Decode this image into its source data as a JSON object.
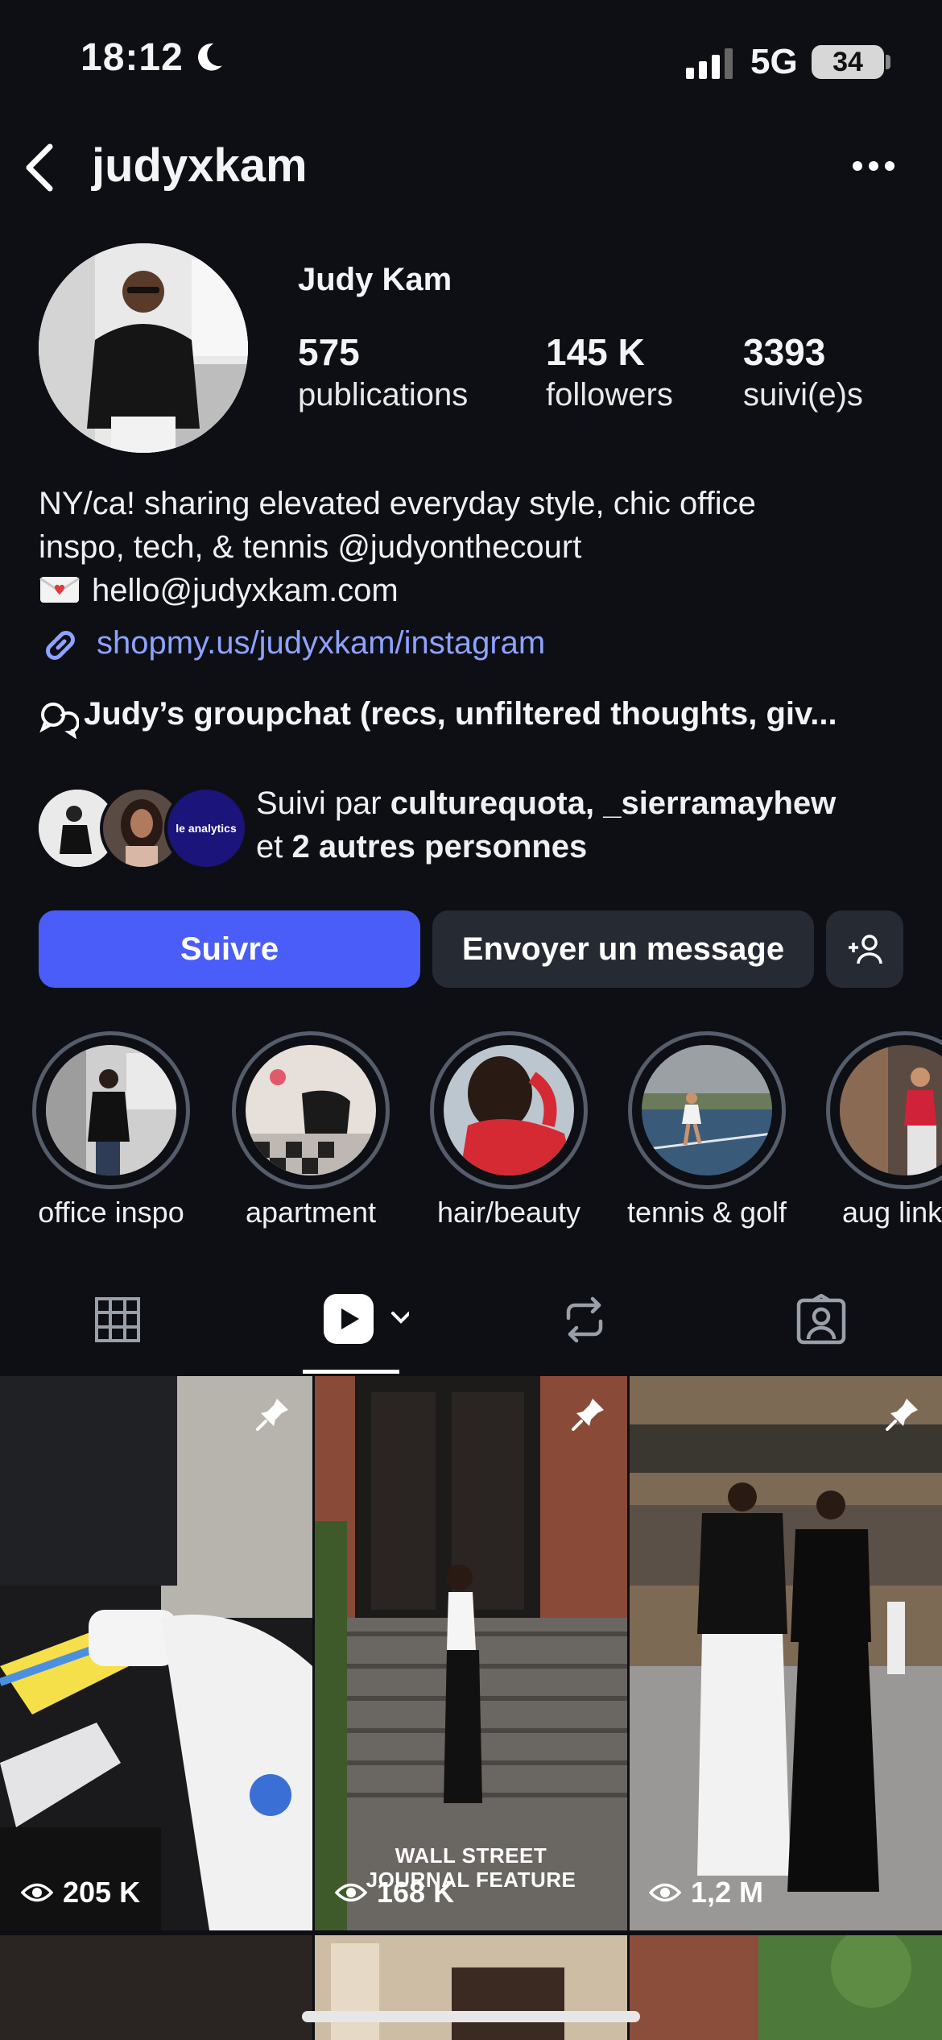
{
  "status_bar": {
    "time": "18:12",
    "network": "5G",
    "battery": "34"
  },
  "header": {
    "username": "judyxkam"
  },
  "profile": {
    "display_name": "Judy Kam",
    "stats": [
      {
        "value": "575",
        "label": "publications"
      },
      {
        "value": "145 K",
        "label": "followers"
      },
      {
        "value": "3393",
        "label": "suivi(e)s"
      }
    ],
    "bio_line1": "NY/ca! sharing elevated everyday style, chic office",
    "bio_line2": "inspo, tech, & tennis @judyonthecourt",
    "email": "hello@judyxkam.com",
    "link": "shopmy.us/judyxkam/instagram",
    "groupchat": "Judy’s groupchat (recs, unfiltered thoughts, giv...",
    "followed_by_prefix": "Suivi par ",
    "followed_by_names": "culturequota, _sierramayhew",
    "followed_by_sep": "et ",
    "followed_by_more": "2 autres personnes",
    "mini_avatar_text": "le analytics"
  },
  "actions": {
    "follow": "Suivre",
    "message": "Envoyer un message"
  },
  "highlights": [
    "office inspo",
    "apartment",
    "hair/beauty",
    "tennis & golf",
    "aug link"
  ],
  "posts": [
    {
      "views": "205 K"
    },
    {
      "views": "168 K",
      "overlay": "WALL STREET JOURNAL FEATURE"
    },
    {
      "views": "1,2 M"
    }
  ],
  "colors": {
    "accent": "#4a5df9",
    "link": "#8ea2ff",
    "background": "#0d0f14"
  }
}
